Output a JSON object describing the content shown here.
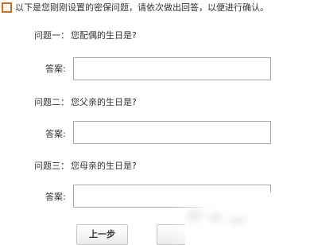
{
  "intro_text": "以下是您刚刚设置的密保问题，请依次做出回答，以便进行确认。",
  "questions": [
    {
      "label": "问题一：",
      "text": "您配偶的生日是?",
      "answer_label": "答案:",
      "answer_value": ""
    },
    {
      "label": "问题二：",
      "text": "您父亲的生日是?",
      "answer_label": "答案:",
      "answer_value": ""
    },
    {
      "label": "问题三：",
      "text": "您母亲的生日是?",
      "answer_label": "答案:",
      "answer_value": ""
    }
  ],
  "buttons": {
    "prev_label": "上一步",
    "next_label": ""
  }
}
